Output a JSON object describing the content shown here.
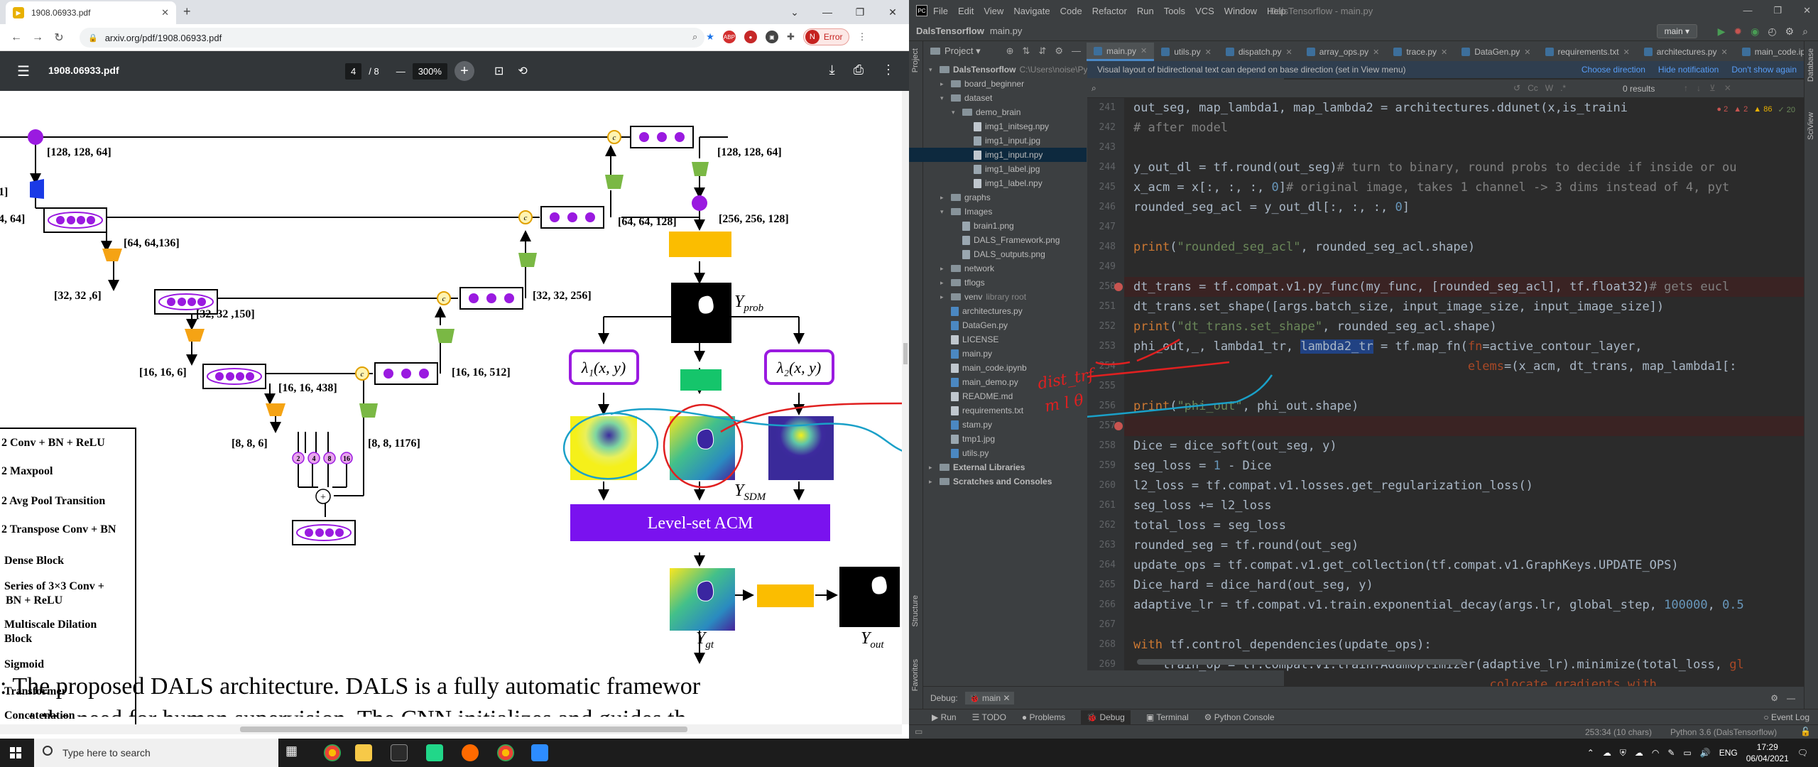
{
  "browser": {
    "tab_title": "1908.06933.pdf",
    "url": "arxiv.org/pdf/1908.06933.pdf",
    "error_label": "Error",
    "profile_initial": "N",
    "pdf": {
      "filename": "1908.06933.pdf",
      "page_current": "4",
      "page_total": "/ 8",
      "zoom": "300%"
    }
  },
  "figure": {
    "dims": {
      "d1": "[128, 128, 64]",
      "d2": "[128, 128, 64]",
      "d3": "[64, 64, 128]",
      "d4": "[256, 256, 128]",
      "d5": "[64, 64,136]",
      "d6": "[32, 32 ,6]",
      "d7": "[32, 32 ,150]",
      "d8": "[32, 32, 256]",
      "d9": "[16, 16, 6]",
      "d10": "[16, 16, 438]",
      "d11": "[16, 16, 512]",
      "d12": "[8, 8, 6]",
      "d13": "[8, 8, 1176]",
      "d14": "4, 64]",
      "d15": "1]"
    },
    "y_prob": "Y",
    "y_prob_sub": "prob",
    "y_sdm": "Y",
    "y_sdm_sub": "SDM",
    "y_gt": "Y",
    "y_gt_sub": "gt",
    "y_out": "Y",
    "y_out_sub": "out",
    "lambda1": "λ₁(x, y)",
    "lambda2": "λ₂(x, y)",
    "acm_label": "Level-set ACM",
    "concat_symbol": "c",
    "plus_symbol": "+",
    "dilations": [
      "2",
      "4",
      "8",
      "16"
    ],
    "legend": [
      "2 Conv + BN + ReLU",
      "2 Maxpool",
      "2 Avg Pool Transition",
      "2 Transpose Conv + BN",
      "Dense Block",
      "Series of 3×3 Conv +",
      "BN + ReLU",
      "Multiscale Dilation",
      "Block",
      "Sigmoid",
      "Transformer",
      "Concatenation"
    ],
    "caption_line1": ": The proposed DALS architecture. DALS is a fully automatic framewor",
    "caption_line2": "t the need for human supervision. The CNN initializes and guides th"
  },
  "annotations": {
    "red_text_1": "dist_trf",
    "red_text_2": "m l θ"
  },
  "ide": {
    "menu": [
      "File",
      "Edit",
      "View",
      "Navigate",
      "Code",
      "Refactor",
      "Run",
      "Tools",
      "VCS",
      "Window",
      "Help"
    ],
    "window_title": "DalsTensorflow - main.py",
    "project_name": "DalsTensorflow",
    "breadcrumb_file": "main.py",
    "run_config": "main",
    "project_label": "Project",
    "editor_tabs": [
      "main.py",
      "utils.py",
      "dispatch.py",
      "array_ops.py",
      "trace.py",
      "DataGen.py",
      "requirements.txt",
      "architectures.py",
      "main_code.ipynb"
    ],
    "tree": [
      {
        "label": "DalsTensorflow",
        "hint": "C:\\Users\\noise\\Py",
        "level": 0,
        "type": "folder",
        "open": true
      },
      {
        "label": "board_beginner",
        "level": 1,
        "type": "folder",
        "open": false
      },
      {
        "label": "dataset",
        "level": 1,
        "type": "folder",
        "open": true
      },
      {
        "label": "demo_brain",
        "level": 2,
        "type": "folder",
        "open": true
      },
      {
        "label": "img1_initseg.npy",
        "level": 3,
        "type": "file"
      },
      {
        "label": "img1_input.jpg",
        "level": 3,
        "type": "img"
      },
      {
        "label": "img1_input.npy",
        "level": 3,
        "type": "file",
        "selected": true
      },
      {
        "label": "img1_label.jpg",
        "level": 3,
        "type": "img"
      },
      {
        "label": "img1_label.npy",
        "level": 3,
        "type": "file"
      },
      {
        "label": "graphs",
        "level": 1,
        "type": "folder",
        "open": false
      },
      {
        "label": "Images",
        "level": 1,
        "type": "folder",
        "open": true
      },
      {
        "label": "brain1.png",
        "level": 2,
        "type": "img"
      },
      {
        "label": "DALS_Framework.png",
        "level": 2,
        "type": "img"
      },
      {
        "label": "DALS_outputs.png",
        "level": 2,
        "type": "img"
      },
      {
        "label": "network",
        "level": 1,
        "type": "folder",
        "open": false
      },
      {
        "label": "tflogs",
        "level": 1,
        "type": "folder",
        "open": false
      },
      {
        "label": "venv",
        "hint": "library root",
        "level": 1,
        "type": "folder",
        "open": false
      },
      {
        "label": "architectures.py",
        "level": 1,
        "type": "py"
      },
      {
        "label": "DataGen.py",
        "level": 1,
        "type": "py"
      },
      {
        "label": "LICENSE",
        "level": 1,
        "type": "file"
      },
      {
        "label": "main.py",
        "level": 1,
        "type": "py"
      },
      {
        "label": "main_code.ipynb",
        "level": 1,
        "type": "file"
      },
      {
        "label": "main_demo.py",
        "level": 1,
        "type": "py"
      },
      {
        "label": "README.md",
        "level": 1,
        "type": "file"
      },
      {
        "label": "requirements.txt",
        "level": 1,
        "type": "file"
      },
      {
        "label": "stam.py",
        "level": 1,
        "type": "py"
      },
      {
        "label": "tmp1.jpg",
        "level": 1,
        "type": "img"
      },
      {
        "label": "utils.py",
        "level": 1,
        "type": "py"
      },
      {
        "label": "External Libraries",
        "level": 0,
        "type": "folder",
        "open": false
      },
      {
        "label": "Scratches and Consoles",
        "level": 0,
        "type": "folder",
        "open": false
      }
    ],
    "notification": "Visual layout of bidirectional text can depend on base direction (set in View menu)",
    "notification_links": [
      "Choose direction",
      "Hide notification",
      "Don't show again"
    ],
    "find_results": "0 results",
    "inspection_counts": [
      "2",
      "2",
      "86",
      "20"
    ],
    "code_lines": [
      {
        "n": "241",
        "bp": false
      },
      {
        "n": "242",
        "bp": false
      },
      {
        "n": "243",
        "bp": false
      },
      {
        "n": "244",
        "bp": false
      },
      {
        "n": "245",
        "bp": false
      },
      {
        "n": "246",
        "bp": false
      },
      {
        "n": "247",
        "bp": false
      },
      {
        "n": "248",
        "bp": false
      },
      {
        "n": "249",
        "bp": false
      },
      {
        "n": "250",
        "bp": true
      },
      {
        "n": "251",
        "bp": false
      },
      {
        "n": "252",
        "bp": false
      },
      {
        "n": "253",
        "bp": false
      },
      {
        "n": "254",
        "bp": false
      },
      {
        "n": "255",
        "bp": false
      },
      {
        "n": "256",
        "bp": false
      },
      {
        "n": "257",
        "bp": true
      },
      {
        "n": "258",
        "bp": false
      },
      {
        "n": "259",
        "bp": false
      },
      {
        "n": "260",
        "bp": false
      },
      {
        "n": "261",
        "bp": false
      },
      {
        "n": "262",
        "bp": false
      },
      {
        "n": "263",
        "bp": false
      },
      {
        "n": "264",
        "bp": false
      },
      {
        "n": "265",
        "bp": false
      },
      {
        "n": "266",
        "bp": false
      },
      {
        "n": "267",
        "bp": false
      },
      {
        "n": "268",
        "bp": false
      },
      {
        "n": "269",
        "bp": false
      }
    ],
    "debug_label": "Debug:",
    "debug_config": "main",
    "bottom_tabs": [
      "Run",
      "TODO",
      "Problems",
      "Debug",
      "Terminal",
      "Python Console"
    ],
    "event_log": "Event Log",
    "status_position": "253:34 (10 chars)",
    "status_interpreter": "Python 3.6 (DalsTensorflow)"
  },
  "taskbar": {
    "search_placeholder": "Type here to search",
    "lang": "ENG",
    "time": "17:29",
    "date": "06/04/2021"
  }
}
